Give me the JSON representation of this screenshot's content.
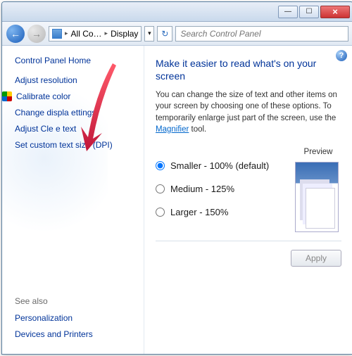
{
  "window": {
    "min": "—",
    "max": "☐",
    "close": "×"
  },
  "nav": {
    "back": "←",
    "fwd": "→",
    "crumb1": "All Co…",
    "crumb2": "Display",
    "dropdown": "▾",
    "refresh": "↻",
    "search_placeholder": "Search Control Panel"
  },
  "sidebar": {
    "home": "Control Panel Home",
    "links": {
      "adjust_resolution": "Adjust resolution",
      "calibrate_color": "Calibrate color",
      "change_display": "Change displa     ettings",
      "adjust_cleartype": "Adjust Cle           e text",
      "set_custom_dpi": "Set custom text size (DPI)"
    },
    "see_also": "See also",
    "personalization": "Personalization",
    "devices": "Devices and Printers"
  },
  "content": {
    "help": "?",
    "heading": "Make it easier to read what's on your screen",
    "desc_pre": "You can change the size of text and other items on your screen by choosing one of these options. To temporarily enlarge just part of the screen, use the ",
    "magnifier": "Magnifier",
    "desc_post": " tool.",
    "opt_smaller": "Smaller - 100% (default)",
    "opt_medium": "Medium - 125%",
    "opt_larger": "Larger - 150%",
    "preview_label": "Preview",
    "apply": "Apply"
  }
}
